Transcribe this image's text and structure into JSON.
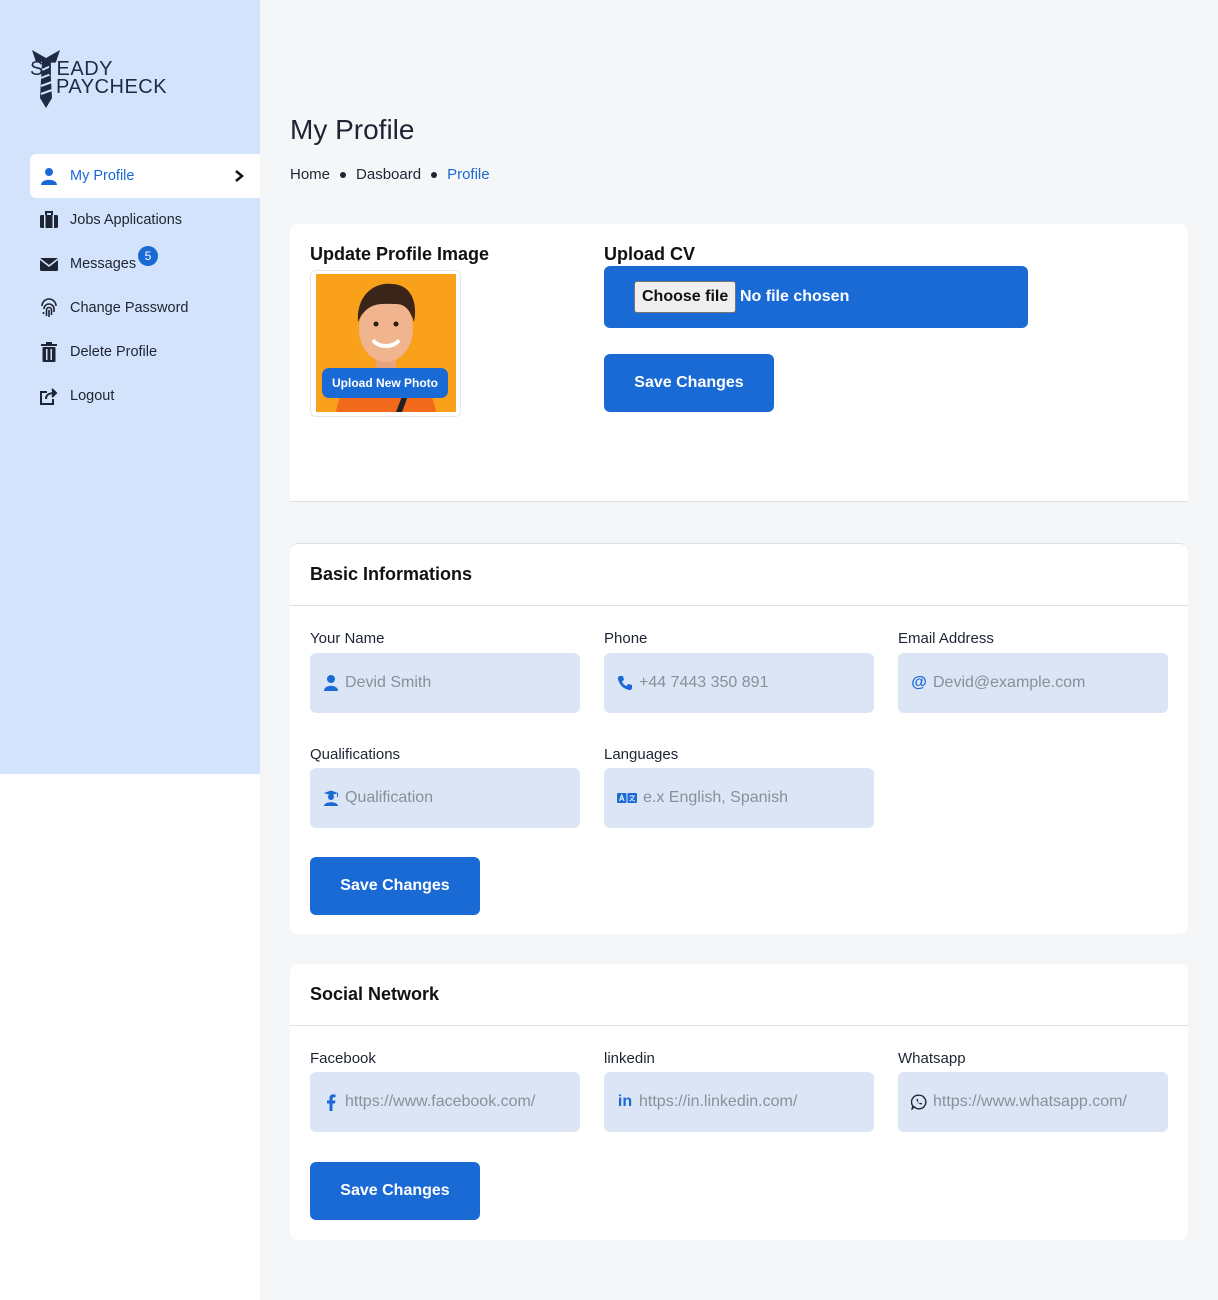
{
  "brand": {
    "line1": "STEADY",
    "line2": "PAYCHECK"
  },
  "sidebar": {
    "items": [
      {
        "label": "My Profile",
        "icon": "user-icon"
      },
      {
        "label": "Jobs Applications",
        "icon": "briefcase-icon"
      },
      {
        "label": "Messages",
        "icon": "envelope-icon",
        "badge": "5"
      },
      {
        "label": "Change Password",
        "icon": "fingerprint-icon"
      },
      {
        "label": "Delete Profile",
        "icon": "trash-icon"
      },
      {
        "label": "Logout",
        "icon": "share-out-icon"
      }
    ]
  },
  "header": {
    "title": "My Profile",
    "breadcrumb": [
      "Home",
      "Dasboard",
      "Profile"
    ]
  },
  "upload_section": {
    "image_label": "Update Profile Image",
    "upload_photo_label": "Upload New Photo",
    "cv_label": "Upload CV",
    "choose_file_label": "Choose file",
    "no_file_label": "No file chosen",
    "save_label": "Save Changes"
  },
  "basic_info": {
    "title": "Basic Informations",
    "fields": {
      "name": {
        "label": "Your Name",
        "placeholder": "Devid Smith"
      },
      "phone": {
        "label": "Phone",
        "placeholder": "+44 7443 350 891"
      },
      "email": {
        "label": "Email Address",
        "placeholder": "Devid@example.com"
      },
      "qualifications": {
        "label": "Qualifications",
        "placeholder": "Qualification"
      },
      "languages": {
        "label": "Languages",
        "placeholder": "e.x English, Spanish"
      }
    },
    "save_label": "Save Changes"
  },
  "social": {
    "title": "Social Network",
    "fields": {
      "facebook": {
        "label": "Facebook",
        "placeholder": "https://www.facebook.com/"
      },
      "linkedin": {
        "label": "linkedin",
        "placeholder": "https://in.linkedin.com/"
      },
      "whatsapp": {
        "label": "Whatsapp",
        "placeholder": "https://www.whatsapp.com/"
      }
    },
    "save_label": "Save Changes"
  },
  "colors": {
    "accent": "#1a6ad6",
    "sidebar_bg": "#d3e3fb",
    "input_bg": "#dbe5f5",
    "photo_bg": "#f9a11b"
  }
}
